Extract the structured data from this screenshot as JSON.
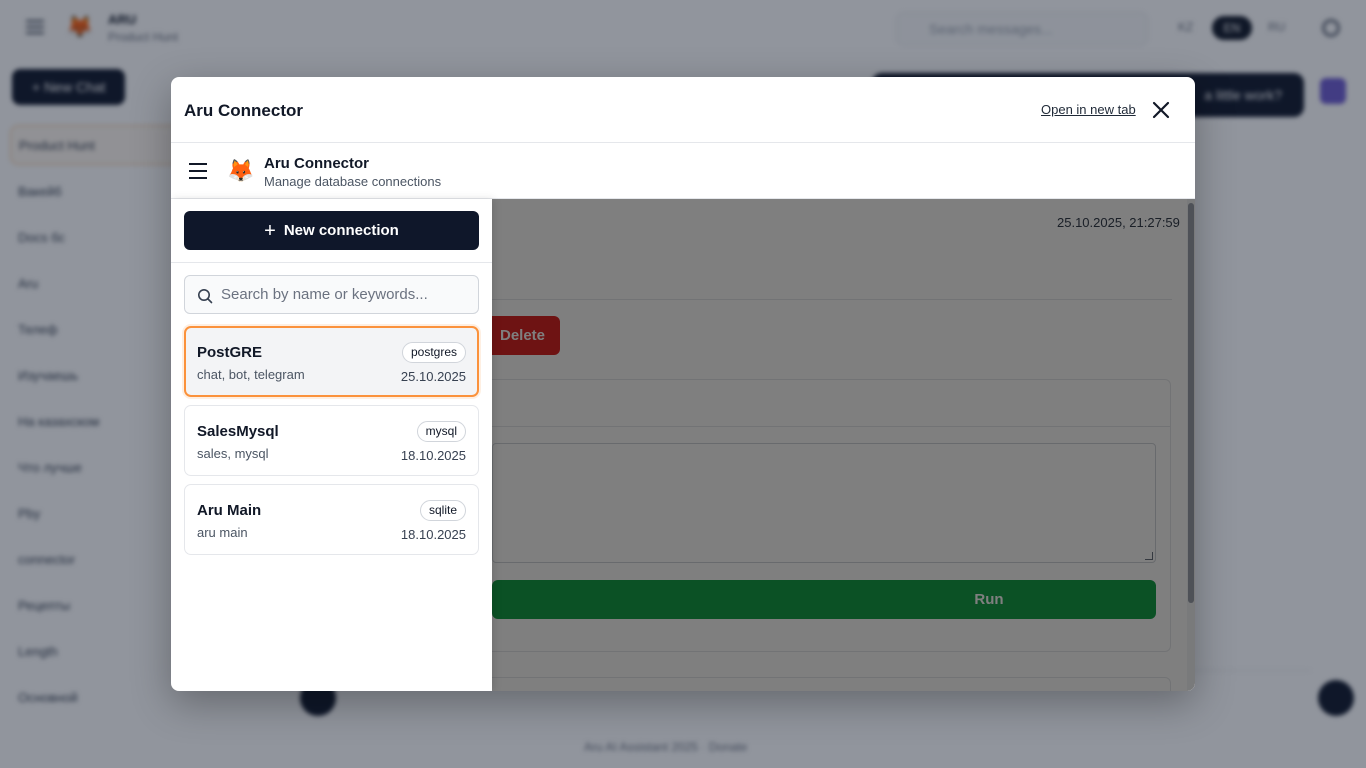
{
  "background": {
    "app_title": "ARU",
    "app_subtitle": "Product Hunt",
    "search_placeholder": "Search messages...",
    "lang_options": [
      "KZ",
      "EN",
      "RU"
    ],
    "new_chat_label": "+ New Chat",
    "sidebar_items": [
      "Product Hunt",
      "Вакейб",
      "Docs бс",
      "Aru",
      "Телеф",
      "Изучаешь",
      "На казахском",
      "Что лучше",
      "Рby",
      "connector",
      "Рецепты",
      "Length",
      "Основной"
    ],
    "dark_pill_text": "a little work?",
    "footer_text": "Aru AI Assistant 2025 · Donate"
  },
  "modal": {
    "title": "Aru Connector",
    "open_new_tab": "Open in new tab"
  },
  "app": {
    "title": "Aru Connector",
    "subtitle": "Manage database connections"
  },
  "content": {
    "timestamp": "25.10.2025, 21:27:59",
    "delete_label": "Delete",
    "run_label": "Run"
  },
  "drawer": {
    "new_connection_label": "New connection",
    "search_placeholder": "Search by name or keywords...",
    "connections": [
      {
        "name": "PostGRE",
        "tags": "chat, bot, telegram",
        "type": "postgres",
        "date": "25.10.2025"
      },
      {
        "name": "SalesMysql",
        "tags": "sales, mysql",
        "type": "mysql",
        "date": "18.10.2025"
      },
      {
        "name": "Aru Main",
        "tags": "aru main",
        "type": "sqlite",
        "date": "18.10.2025"
      }
    ]
  },
  "colors": {
    "primary_dark": "#0f172a",
    "danger": "#dc2626",
    "success": "#16a34a",
    "selected_border": "#fb923c"
  }
}
